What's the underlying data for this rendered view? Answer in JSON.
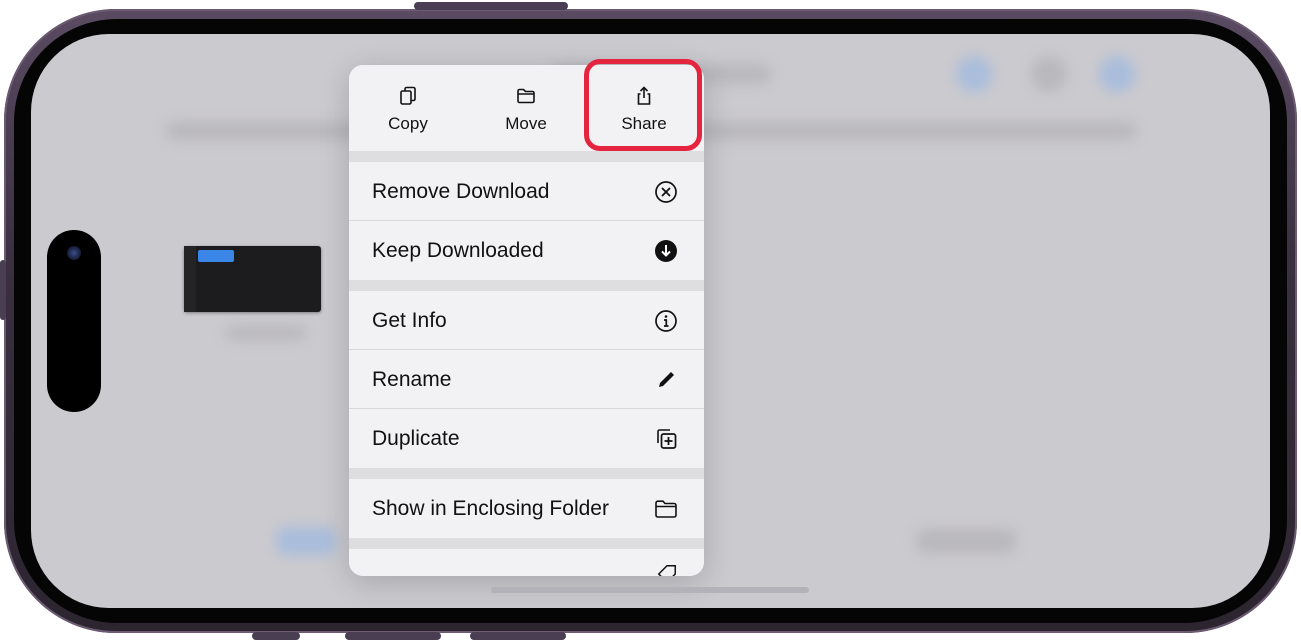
{
  "quick_actions": [
    {
      "label": "Copy",
      "icon": "copy-icon"
    },
    {
      "label": "Move",
      "icon": "folder-icon"
    },
    {
      "label": "Share",
      "icon": "share-icon"
    }
  ],
  "menu_items": [
    {
      "label": "Remove Download",
      "icon": "remove-circle-icon"
    },
    {
      "label": "Keep Downloaded",
      "icon": "download-circle-icon"
    },
    {
      "label": "Get Info",
      "icon": "info-icon"
    },
    {
      "label": "Rename",
      "icon": "pencil-icon"
    },
    {
      "label": "Duplicate",
      "icon": "duplicate-icon"
    },
    {
      "label": "Show in Enclosing Folder",
      "icon": "folder-icon"
    }
  ],
  "colors": {
    "highlight": "#e5253f",
    "menu_background": "#f2f2f4",
    "screen_background": "#cbcacf"
  }
}
